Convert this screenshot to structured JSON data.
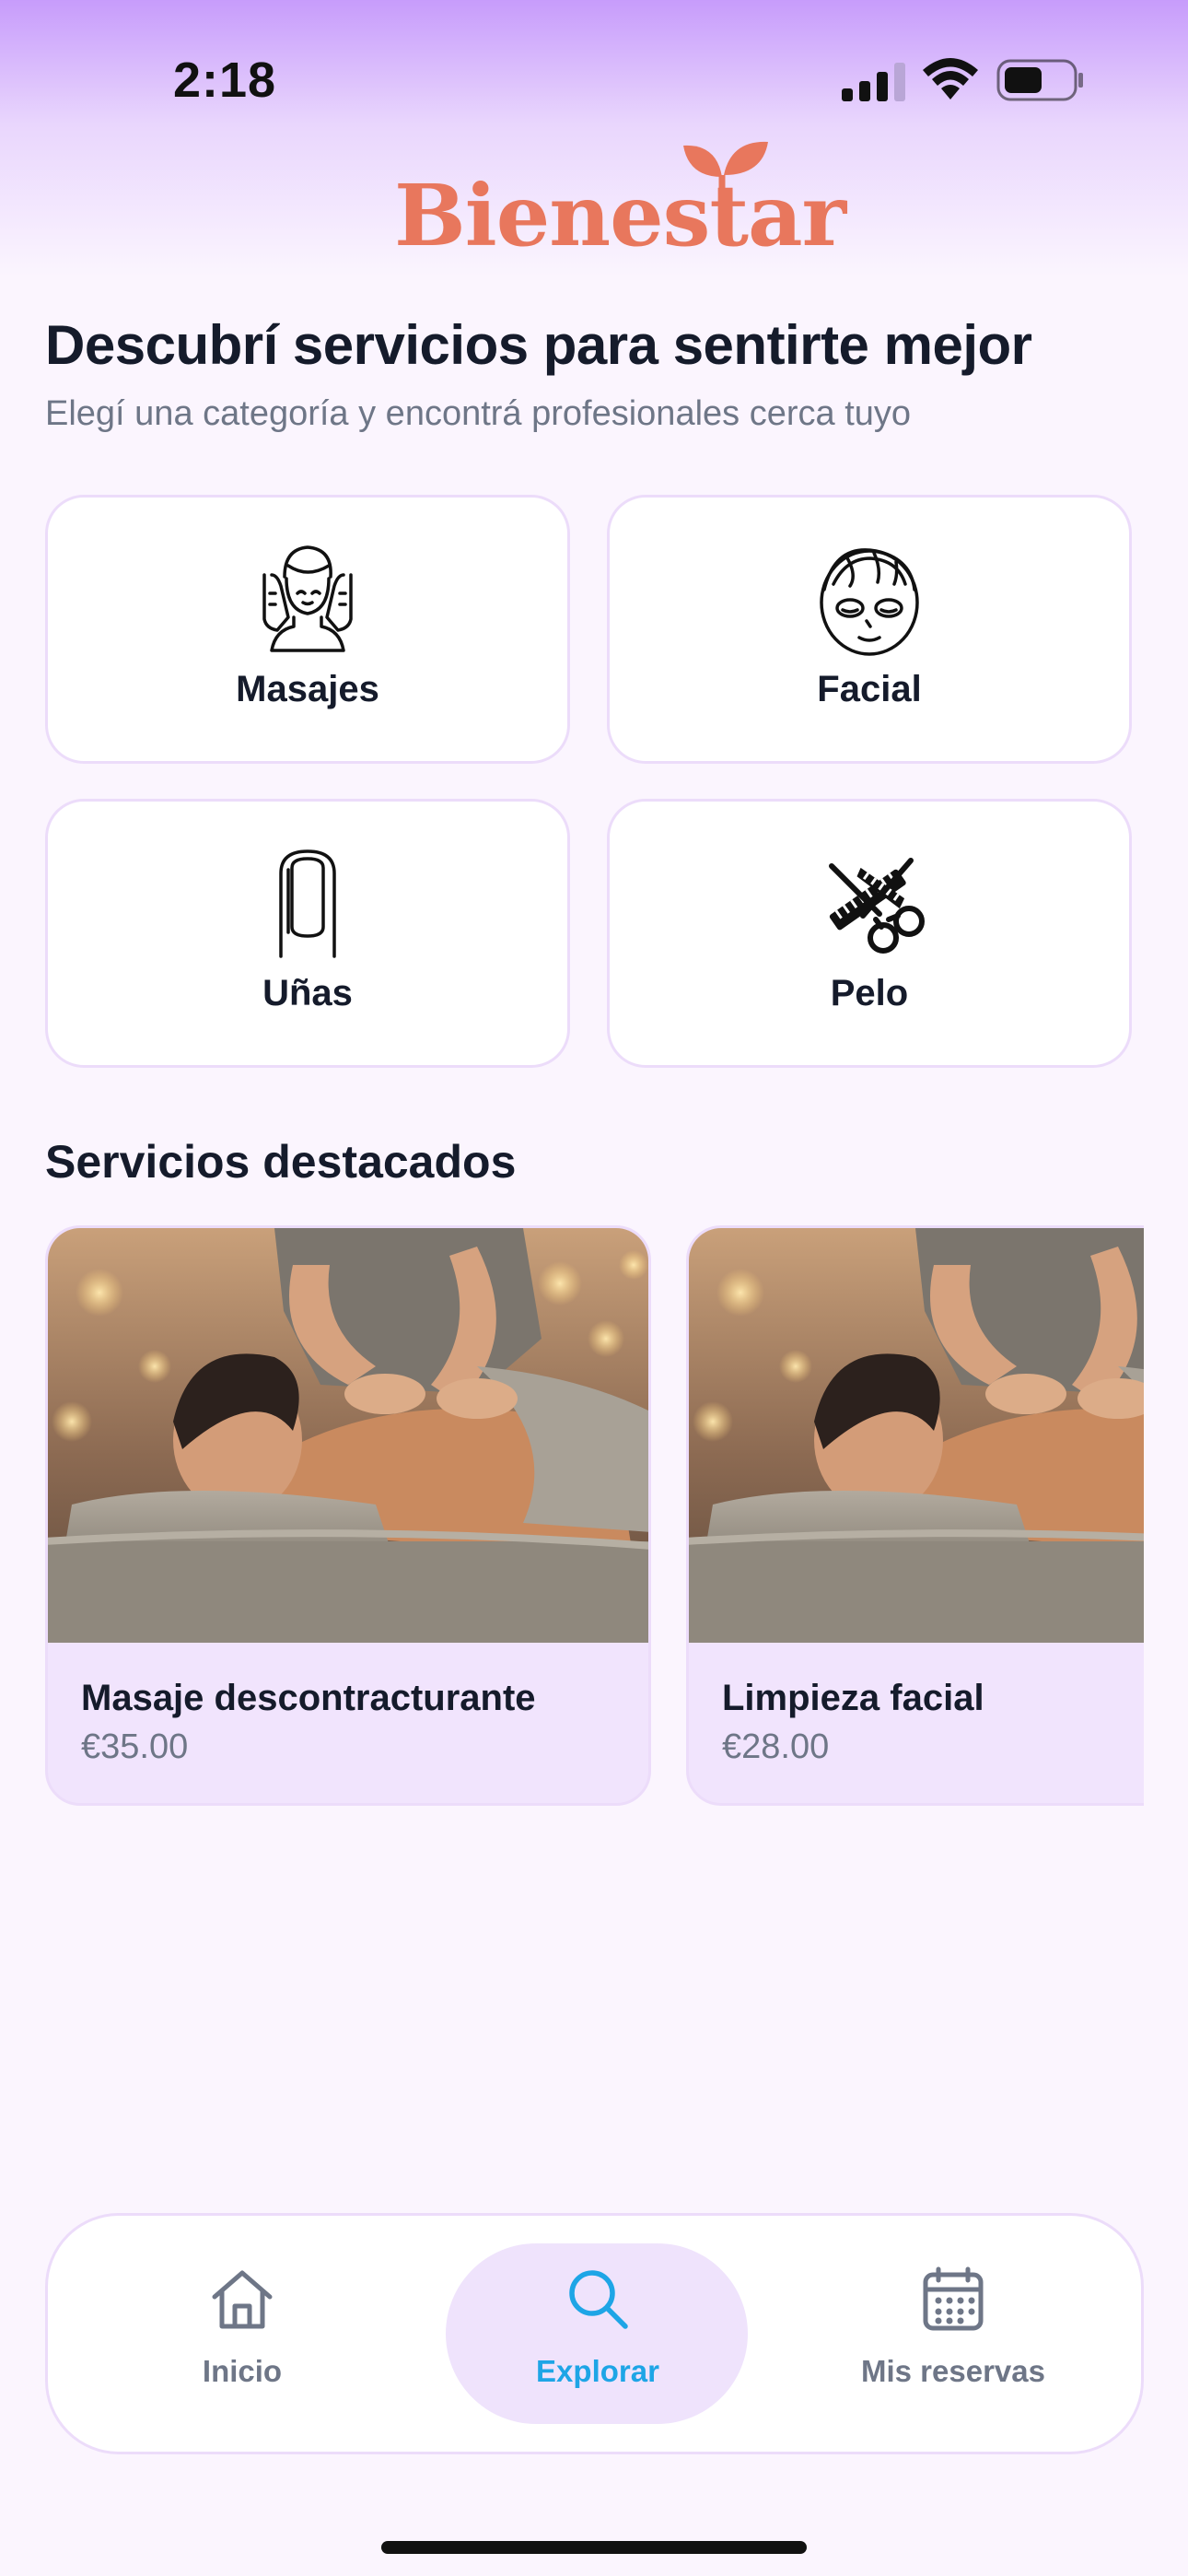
{
  "status_bar": {
    "time": "2:18"
  },
  "brand": {
    "name": "Bienestar",
    "color": "#e8775d"
  },
  "header": {
    "title": "Descubrí servicios para sentirte mejor",
    "subtitle": "Elegí una categoría y encontrá profesionales cerca tuyo"
  },
  "categories": [
    {
      "label": "Masajes",
      "icon": "massage-face-icon"
    },
    {
      "label": "Facial",
      "icon": "face-mask-icon"
    },
    {
      "label": "Uñas",
      "icon": "nail-icon"
    },
    {
      "label": "Pelo",
      "icon": "scissors-comb-icon"
    }
  ],
  "featured": {
    "title": "Servicios destacados",
    "items": [
      {
        "name": "Masaje descontracturante",
        "price": "€35.00"
      },
      {
        "name": "Limpieza facial",
        "price": "€28.00"
      }
    ]
  },
  "nav": {
    "active": "explorar",
    "items": [
      {
        "label": "Inicio",
        "icon": "home-icon"
      },
      {
        "label": "Explorar",
        "icon": "search-icon"
      },
      {
        "label": "Mis reservas",
        "icon": "calendar-icon"
      }
    ]
  },
  "colors": {
    "accent": "#1ea5e6",
    "card_border": "#ecdcfa",
    "featured_bg": "#f1e4fd",
    "background": "#fbf5fe"
  }
}
